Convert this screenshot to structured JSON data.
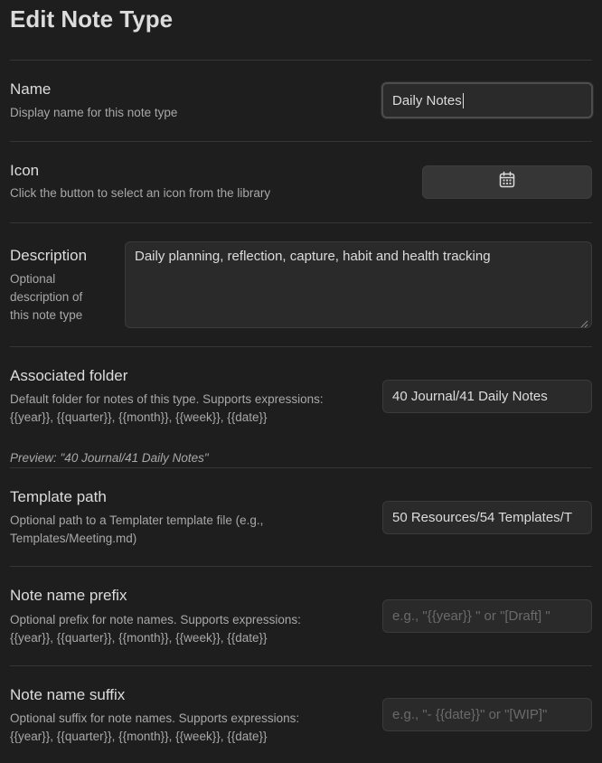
{
  "page": {
    "title": "Edit Note Type"
  },
  "settings": [
    {
      "label": "Name",
      "description": "Display name for this note type",
      "value": "Daily Notes"
    },
    {
      "label": "Icon",
      "description": "Click the button to select an icon from the library",
      "icon": "calendar-icon"
    },
    {
      "label": "Description",
      "description_lines": [
        "Optional",
        "description of",
        "this note type"
      ],
      "value": "Daily planning, reflection, capture, habit and health tracking"
    },
    {
      "label": "Associated folder",
      "description_lines": [
        "Default folder for notes of this type. Supports expressions:",
        "{{year}}, {{quarter}}, {{month}}, {{week}}, {{date}}"
      ],
      "value": "40 Journal/41 Daily Notes",
      "preview": "Preview: \"40 Journal/41 Daily Notes\""
    },
    {
      "label": "Template path",
      "description_lines": [
        "Optional path to a Templater template file (e.g.,",
        "Templates/Meeting.md)"
      ],
      "value": "50 Resources/54 Templates/T"
    },
    {
      "label": "Note name prefix",
      "description_lines": [
        "Optional prefix for note names. Supports expressions:",
        "{{year}}, {{quarter}}, {{month}}, {{week}}, {{date}}"
      ],
      "placeholder": "e.g., \"{{year}} \" or \"[Draft] \""
    },
    {
      "label": "Note name suffix",
      "description_lines": [
        "Optional suffix for note names. Supports expressions:",
        "{{year}}, {{quarter}}, {{month}}, {{week}}, {{date}}"
      ],
      "placeholder": "e.g., \"- {{date}}\" or \"[WIP]\""
    }
  ]
}
